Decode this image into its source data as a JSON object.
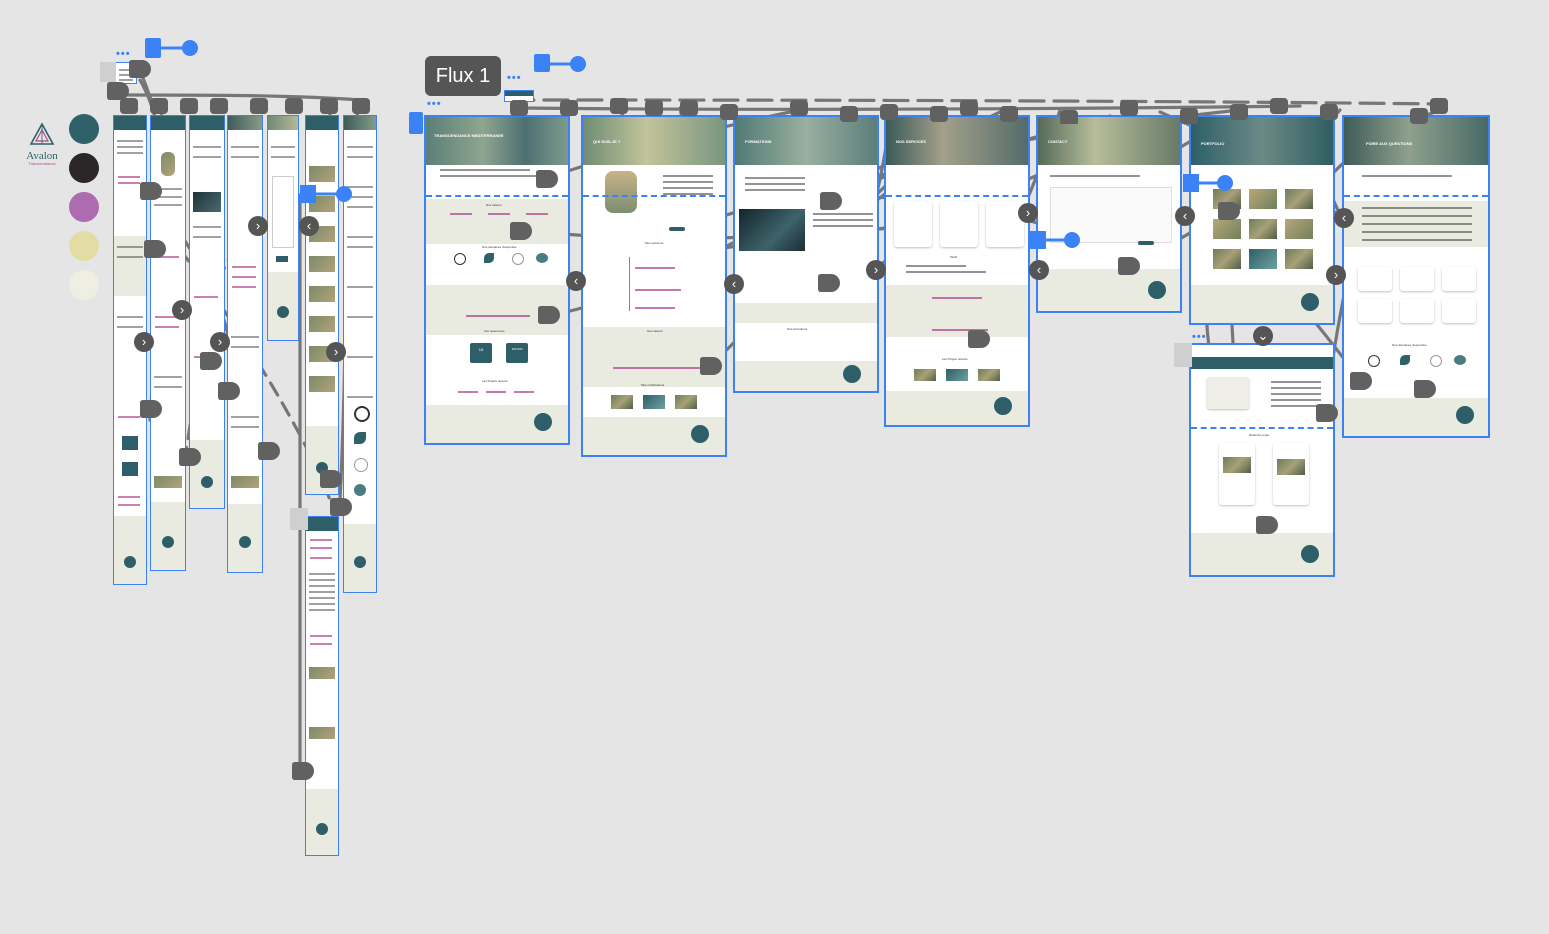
{
  "canvas": {
    "background": "#e5e5e5"
  },
  "flow": {
    "label": "Flux 1"
  },
  "brand": {
    "name": "Avalon",
    "subtitle": "Transcendance"
  },
  "palette": {
    "swatches": [
      {
        "name": "teal",
        "color": "#2e6168"
      },
      {
        "name": "dark",
        "color": "#2b2628"
      },
      {
        "name": "purple",
        "color": "#ad6bb0"
      },
      {
        "name": "sand",
        "color": "#e3dca3"
      },
      {
        "name": "cream",
        "color": "#eeefe2"
      }
    ]
  },
  "desktop_frames": [
    {
      "title": "TRANSCENDANCE MEDITERRANEE",
      "sections": [
        "Nos valeurs",
        "Nos domaines d'expertise",
        "Vos ressources",
        "Les Projets récents"
      ],
      "stats": [
        "15",
        "100 000"
      ]
    },
    {
      "title": "QUI SUIS-JE ?",
      "sections": [
        "Mon parcours",
        "Mes certifications",
        "Nos valeurs"
      ]
    },
    {
      "title": "FORMATIONS",
      "sections": [
        "Nos formations",
        "Prochaines sessions"
      ]
    },
    {
      "title": "NOS SERVICES",
      "sections": [
        "Nos services",
        "Tarifs",
        "Les Projets récents"
      ]
    },
    {
      "title": "CONTACT",
      "sections": [
        "Formulaire de contact"
      ]
    },
    {
      "title": "PORTFOLIO",
      "sections": [
        "Nos projets",
        "Détail du projet"
      ]
    },
    {
      "title": "FOIRE AUX QUESTIONS",
      "sections": [
        "Questions fréquentes",
        "Nos domaines d'expertise"
      ]
    }
  ],
  "colors": {
    "frame_border": "#3b82f6",
    "header": "#2e5f68",
    "band": "#e9ebe1",
    "accent_pink": "#b04a8f",
    "connector": "#616161"
  }
}
